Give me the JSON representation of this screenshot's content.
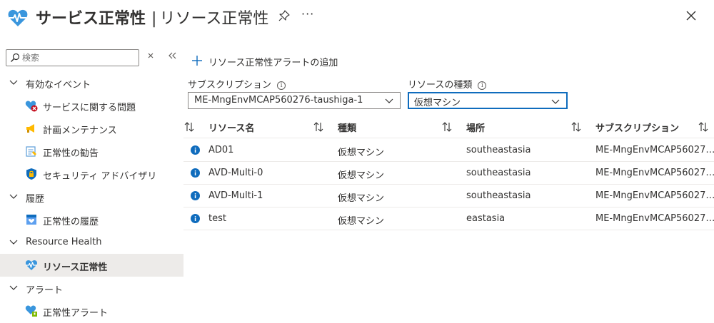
{
  "header": {
    "title_main": "サービス正常性",
    "title_sep": "|",
    "title_sub": "リソース正常性",
    "more": "···",
    "accent_color": "#0078d4"
  },
  "sidebar": {
    "search_placeholder": "検索",
    "groups": [
      {
        "label": "有効なイベント",
        "items": [
          {
            "label": "サービスに関する問題",
            "icon": "service-issue-icon"
          },
          {
            "label": "計画メンテナンス",
            "icon": "megaphone-icon"
          },
          {
            "label": "正常性の勧告",
            "icon": "advisory-icon"
          },
          {
            "label": "セキュリティ アドバイザリ",
            "icon": "shield-icon"
          }
        ]
      },
      {
        "label": "履歴",
        "items": [
          {
            "label": "正常性の履歴",
            "icon": "history-icon"
          }
        ]
      },
      {
        "label": "Resource Health",
        "items": [
          {
            "label": "リソース正常性",
            "icon": "heart-pulse-icon",
            "selected": true
          }
        ]
      },
      {
        "label": "アラート",
        "items": [
          {
            "label": "正常性アラート",
            "icon": "health-alert-icon"
          }
        ]
      }
    ]
  },
  "main": {
    "add_alert_label": "リソース正常性アラートの追加",
    "filters": {
      "subscription_label": "サブスクリプション",
      "subscription_value": "ME-MngEnvMCAP560276-taushiga-1",
      "resource_type_label": "リソースの種類",
      "resource_type_value": "仮想マシン"
    },
    "table": {
      "columns": [
        "リソース名",
        "種類",
        "場所",
        "サブスクリプション"
      ],
      "rows": [
        {
          "name": "AD01",
          "type": "仮想マシン",
          "location": "southeastasia",
          "subscription": "ME-MngEnvMCAP56027…"
        },
        {
          "name": "AVD-Multi-0",
          "type": "仮想マシン",
          "location": "southeastasia",
          "subscription": "ME-MngEnvMCAP56027…"
        },
        {
          "name": "AVD-Multi-1",
          "type": "仮想マシン",
          "location": "southeastasia",
          "subscription": "ME-MngEnvMCAP56027…"
        },
        {
          "name": "test",
          "type": "仮想マシン",
          "location": "eastasia",
          "subscription": "ME-MngEnvMCAP56027…"
        }
      ]
    }
  }
}
